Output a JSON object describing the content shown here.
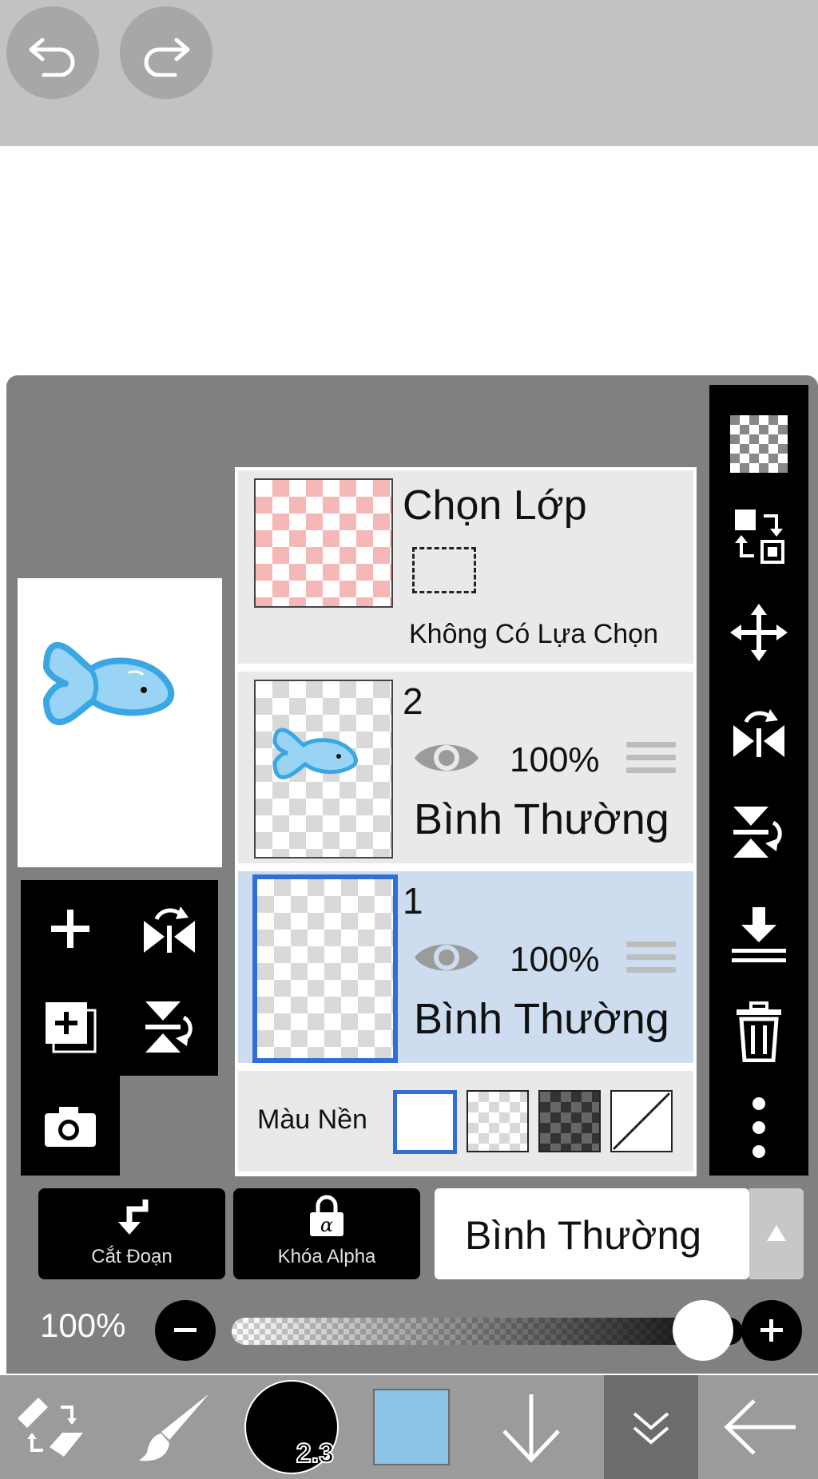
{
  "icons": {
    "undo": "undo-icon",
    "redo": "redo-icon"
  },
  "selection_layer": {
    "title": "Chọn Lớp",
    "subtitle": "Không Có Lựa Chọn"
  },
  "layers": [
    {
      "number": "2",
      "opacity": "100%",
      "blend_mode": "Bình Thường",
      "selected": false
    },
    {
      "number": "1",
      "opacity": "100%",
      "blend_mode": "Bình Thường",
      "selected": true
    }
  ],
  "background_color": {
    "label": "Màu Nền",
    "options": [
      "white",
      "transparent-light",
      "transparent-dark",
      "none"
    ],
    "selected": "white"
  },
  "actions": {
    "clipping_label": "Cắt Đoạn",
    "alpha_lock_label": "Khóa Alpha",
    "blend_mode_value": "Bình Thường"
  },
  "opacity": {
    "label": "100%",
    "value": 1.0
  },
  "brush": {
    "size": "2.3"
  },
  "colors": {
    "current_color": "#8cc4e6",
    "selected_border": "#2f6fd6",
    "selected_row": "#cddcee"
  }
}
